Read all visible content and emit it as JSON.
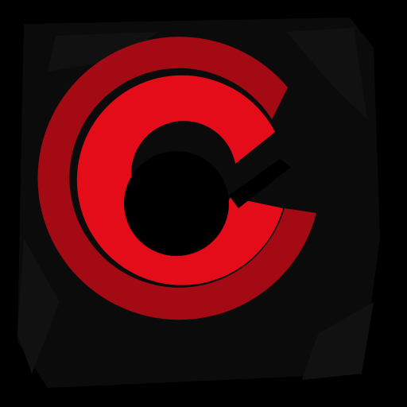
{
  "icon": {
    "name": "red-circular-c-logo",
    "colors": {
      "background": "#000000",
      "texture": "#0b0b0b",
      "outer_ring": "#a40a14",
      "inner_ring": "#e30c18",
      "hole": "#000000"
    }
  }
}
